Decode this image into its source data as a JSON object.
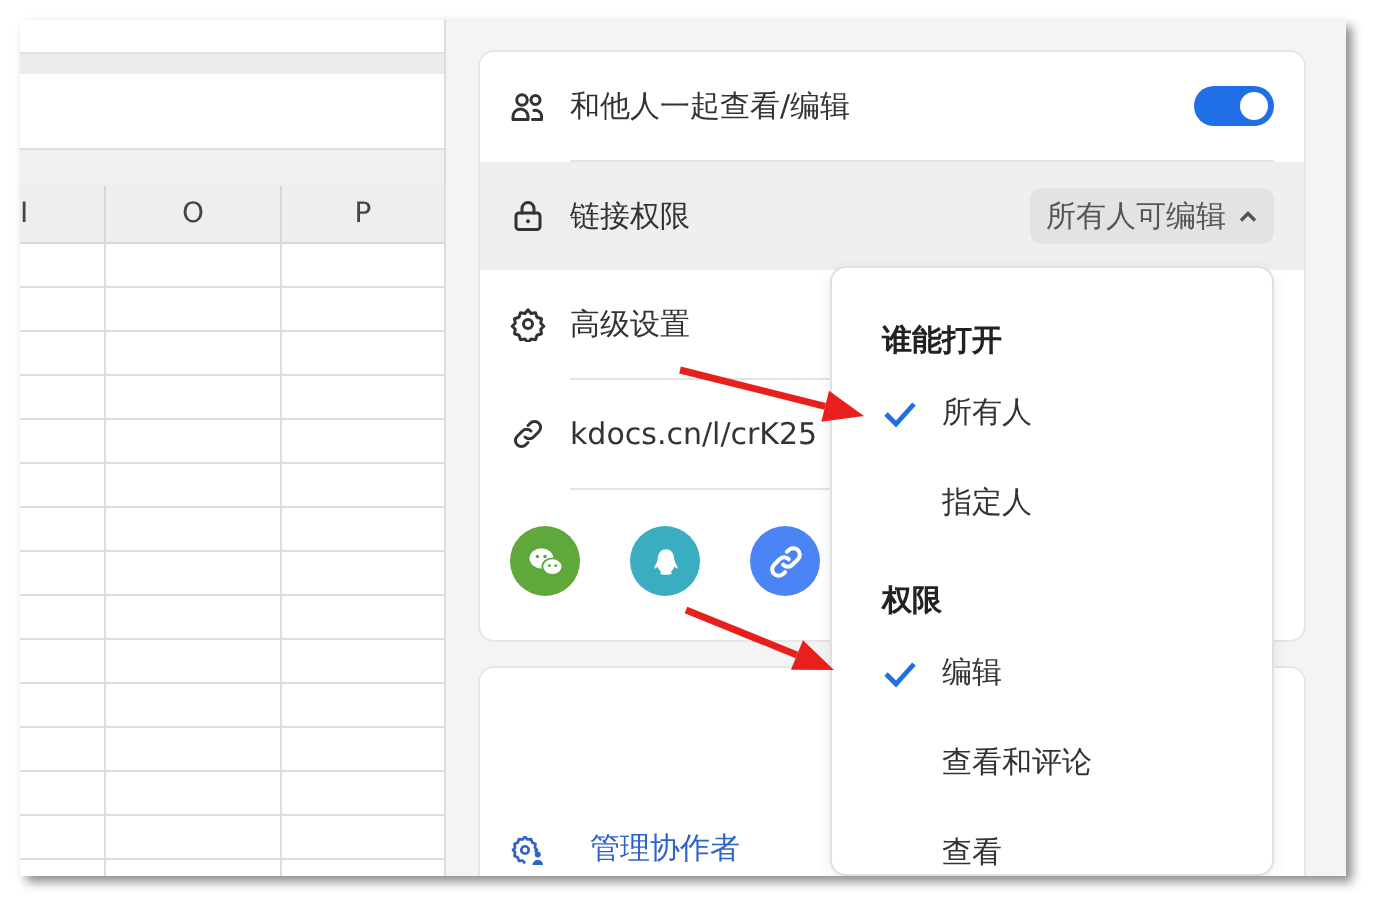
{
  "spreadsheet": {
    "columns": [
      {
        "label": "I"
      },
      {
        "label": "O"
      },
      {
        "label": "P"
      }
    ]
  },
  "share_card": {
    "collab_toggle": {
      "label": "和他人一起查看/编辑",
      "on": true
    },
    "link_permission": {
      "label": "链接权限",
      "value": "所有人可编辑",
      "expanded": true
    },
    "advanced": {
      "label": "高级设置"
    },
    "link": {
      "text": "kdocs.cn/l/crK25"
    },
    "share_targets": [
      {
        "kind": "wechat",
        "color": "#5fa83c"
      },
      {
        "kind": "qq",
        "color": "#3aaec0"
      },
      {
        "kind": "link",
        "color": "#4b85f5"
      }
    ]
  },
  "collaborators_card": {
    "manage_label": "管理协作者"
  },
  "dropdown": {
    "sections": [
      {
        "title": "谁能打开",
        "options": [
          {
            "label": "所有人",
            "selected": true
          },
          {
            "label": "指定人",
            "selected": false
          }
        ]
      },
      {
        "title": "权限",
        "options": [
          {
            "label": "编辑",
            "selected": true
          },
          {
            "label": "查看和评论",
            "selected": false
          },
          {
            "label": "查看",
            "selected": false
          }
        ]
      }
    ]
  }
}
